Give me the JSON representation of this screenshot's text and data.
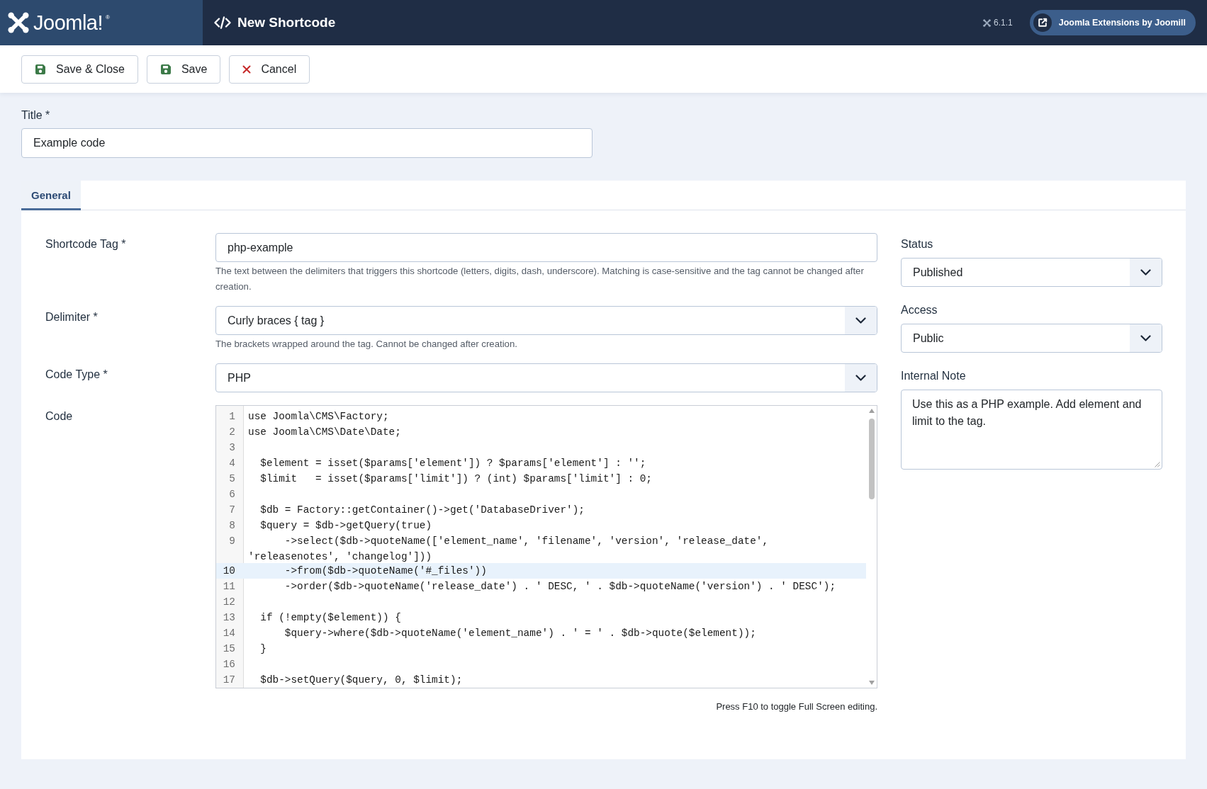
{
  "header": {
    "logo_text": "Joomla!",
    "logo_mark": "®",
    "title": "New Shortcode",
    "version": "6.1.1",
    "link_button": "Joomla Extensions by Joomill"
  },
  "toolbar": {
    "buttons": [
      {
        "kind": "save",
        "label": "Save & Close"
      },
      {
        "kind": "save",
        "label": "Save"
      },
      {
        "kind": "cancel",
        "label": "Cancel"
      }
    ]
  },
  "title_field": {
    "label": "Title *",
    "value": "Example code"
  },
  "tabs": [
    {
      "label": "General",
      "selected": true
    }
  ],
  "fields": [
    {
      "kind": "text",
      "label": "Shortcode Tag *",
      "value": "php-example",
      "help": "The text between the delimiters that triggers this shortcode (letters, digits, dash, underscore). Matching is case-sensitive and the tag cannot be changed after creation."
    },
    {
      "kind": "select",
      "label": "Delimiter *",
      "value": "Curly braces { tag }",
      "help": "The brackets wrapped around the tag. Cannot be changed after creation."
    },
    {
      "kind": "select",
      "label": "Code Type *",
      "value": "PHP"
    },
    {
      "kind": "code",
      "label": "Code",
      "lines": [
        {
          "number": "1",
          "text": "use Joomla\\CMS\\Factory;",
          "active": false
        },
        {
          "number": "2",
          "text": "use Joomla\\CMS\\Date\\Date;",
          "active": false
        },
        {
          "number": "3",
          "active": false
        },
        {
          "number": "4",
          "text": "  $element = isset($params['element']) ? $params['element'] : '';",
          "active": false
        },
        {
          "number": "5",
          "text": "  $limit   = isset($params['limit']) ? (int) $params['limit'] : 0;",
          "active": false
        },
        {
          "number": "6",
          "active": false
        },
        {
          "number": "7",
          "text": "  $db = Factory::getContainer()->get('DatabaseDriver');",
          "active": false
        },
        {
          "number": "8",
          "text": "  $query = $db->getQuery(true)",
          "active": false
        },
        {
          "number": "9",
          "text": "      ->select($db->quoteName(['element_name', 'filename', 'version', 'release_date', 'releasenotes', 'changelog']))",
          "active": false
        },
        {
          "number": "10",
          "text": "      ->from($db->quoteName('#_files'))",
          "active": true
        },
        {
          "number": "11",
          "text": "      ->order($db->quoteName('release_date') . ' DESC, ' . $db->quoteName('version') . ' DESC');",
          "active": false
        },
        {
          "number": "12",
          "active": false
        },
        {
          "number": "13",
          "text": "  if (!empty($element)) {",
          "active": false
        },
        {
          "number": "14",
          "text": "      $query->where($db->quoteName('element_name') . ' = ' . $db->quote($element));",
          "active": false
        },
        {
          "number": "15",
          "text": "  }",
          "active": false
        },
        {
          "number": "16",
          "active": false
        },
        {
          "number": "17",
          "text": "  $db->setQuery($query, 0, $limit);",
          "active": false
        }
      ],
      "footer": "Press F10 to toggle Full Screen editing."
    }
  ],
  "sidebar": [
    {
      "kind": "select",
      "label": "Status",
      "value": "Published"
    },
    {
      "kind": "select",
      "label": "Access",
      "value": "Public"
    },
    {
      "kind": "textarea",
      "label": "Internal Note",
      "value": "Use this as a PHP example. Add element and limit to the tag."
    }
  ]
}
